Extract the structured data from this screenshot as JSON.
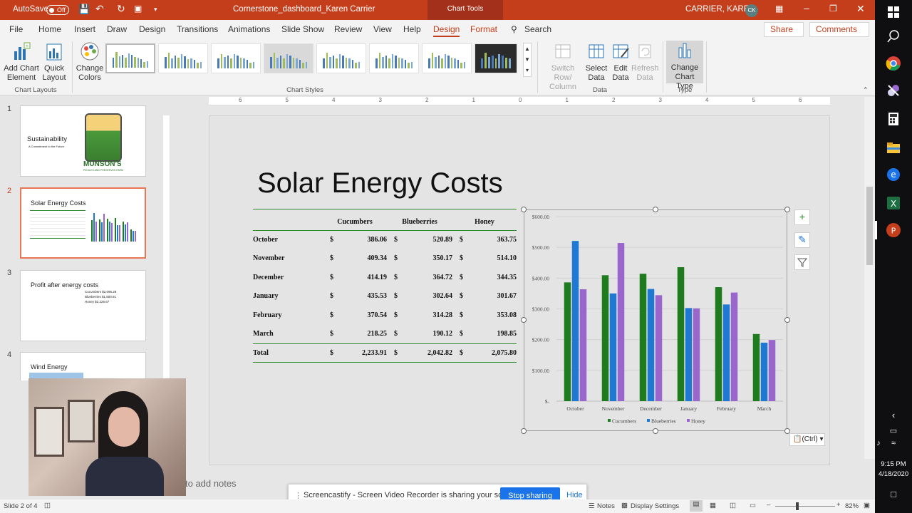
{
  "titlebar": {
    "autosave_label": "AutoSave",
    "autosave_state": "Off",
    "filename": "Cornerstone_dashboard_Karen Carrier",
    "context_tab": "Chart Tools",
    "user_name": "CARRIER, KAREN",
    "user_initials": "CK"
  },
  "menu": {
    "items": [
      "File",
      "Home",
      "Insert",
      "Draw",
      "Design",
      "Transitions",
      "Animations",
      "Slide Show",
      "Review",
      "View",
      "Help",
      "Design",
      "Format"
    ],
    "search": "Search",
    "share": "Share",
    "comments": "Comments"
  },
  "ribbon": {
    "add_chart_element_1": "Add Chart",
    "add_chart_element_2": "Element",
    "quick_layout_1": "Quick",
    "quick_layout_2": "Layout",
    "change_colors_1": "Change",
    "change_colors_2": "Colors",
    "group_chart_layouts": "Chart Layouts",
    "group_chart_styles": "Chart Styles",
    "switch_row_1": "Switch Row/",
    "switch_row_2": "Column",
    "select_data_1": "Select",
    "select_data_2": "Data",
    "edit_data_1": "Edit",
    "edit_data_2": "Data",
    "refresh_data_1": "Refresh",
    "refresh_data_2": "Data",
    "group_data": "Data",
    "change_chart_type_1": "Change",
    "change_chart_type_2": "Chart Type",
    "group_type": "Type"
  },
  "ruler_ticks": [
    "6",
    "5",
    "4",
    "3",
    "2",
    "1",
    "0",
    "1",
    "2",
    "3",
    "4",
    "5",
    "6"
  ],
  "thumbnails": [
    {
      "num": "1",
      "title": "Sustainability",
      "subtitle": "A Commitment to the Future",
      "logo_text": "MUNSON'S",
      "logo_sub": "PICKLES AND PRESERVES FARM"
    },
    {
      "num": "2",
      "title": "Solar Energy Costs"
    },
    {
      "num": "3",
      "title": "Profit after energy costs",
      "bullets": [
        "Cucumbers $2,095.28",
        "Blueberries $1,800.91",
        "Honey $2,226.67"
      ]
    },
    {
      "num": "4",
      "title": "Wind Energy"
    }
  ],
  "slide": {
    "title": "Solar Energy Costs",
    "table": {
      "headers": [
        "Cucumbers",
        "Blueberries",
        "Honey"
      ],
      "currency": "$",
      "rows": [
        {
          "month": "October",
          "values": [
            "386.06",
            "520.89",
            "363.75"
          ]
        },
        {
          "month": "November",
          "values": [
            "409.34",
            "350.17",
            "514.10"
          ]
        },
        {
          "month": "December",
          "values": [
            "414.19",
            "364.72",
            "344.35"
          ]
        },
        {
          "month": "January",
          "values": [
            "435.53",
            "302.64",
            "301.67"
          ]
        },
        {
          "month": "February",
          "values": [
            "370.54",
            "314.28",
            "353.08"
          ]
        },
        {
          "month": "March",
          "values": [
            "218.25",
            "190.12",
            "198.85"
          ]
        }
      ],
      "total_label": "Total",
      "totals": [
        "2,233.91",
        "2,042.82",
        "2,075.80"
      ]
    }
  },
  "chart_data": {
    "type": "bar",
    "categories": [
      "October",
      "November",
      "December",
      "January",
      "February",
      "March"
    ],
    "series": [
      {
        "name": "Cucumbers",
        "values": [
          386.06,
          409.34,
          414.19,
          435.53,
          370.54,
          218.25
        ],
        "color": "#1e7b1e"
      },
      {
        "name": "Blueberries",
        "values": [
          520.89,
          350.17,
          364.72,
          302.64,
          314.28,
          190.12
        ],
        "color": "#1f78d1"
      },
      {
        "name": "Honey",
        "values": [
          363.75,
          514.1,
          344.35,
          301.67,
          353.08,
          198.85
        ],
        "color": "#9966cc"
      }
    ],
    "ylim": [
      0,
      600
    ],
    "yticks": [
      "$-",
      "$100.00",
      "$200.00",
      "$300.00",
      "$400.00",
      "$500.00",
      "$600.00"
    ],
    "legend_position": "bottom",
    "grid": true
  },
  "paste_options": "(Ctrl)",
  "notes_placeholder": "to add notes",
  "screencast": {
    "message": "Screencastify - Screen Video Recorder is sharing your screen.",
    "stop": "Stop sharing",
    "hide": "Hide"
  },
  "status": {
    "slide_info": "Slide 2 of 4",
    "notes": "Notes",
    "display_settings": "Display Settings",
    "zoom": "82%"
  },
  "taskbar": {
    "time": "9:15 PM",
    "date": "4/18/2020"
  },
  "colors": {
    "accent": "#c43e1c",
    "green": "#1e7b1e",
    "blue": "#1f78d1",
    "purple": "#9966cc"
  }
}
